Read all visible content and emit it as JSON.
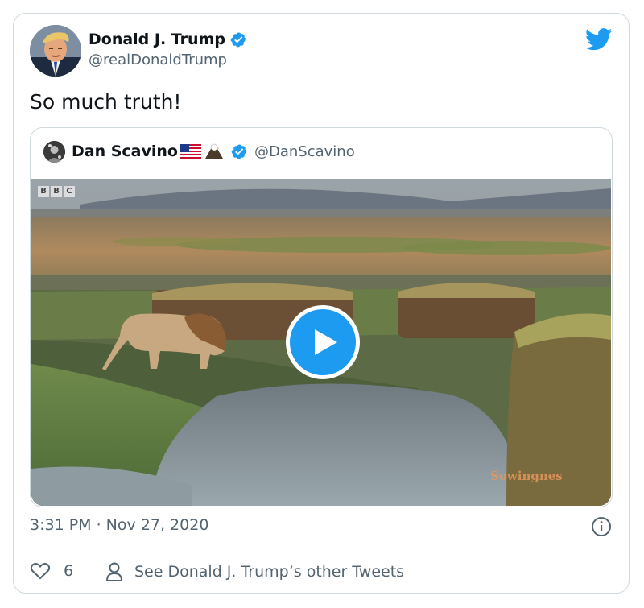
{
  "author": {
    "name": "Donald J. Trump",
    "handle": "@realDonaldTrump",
    "verified": true
  },
  "tweet": {
    "text": "So much truth!",
    "timestamp": "3:31 PM · Nov 27, 2020"
  },
  "quoted_tweet": {
    "name": "Dan Scavino",
    "emojis": [
      "us-flag",
      "eagle"
    ],
    "handle": "@DanScavino",
    "verified": true,
    "video": {
      "channel_logo": [
        "B",
        "B",
        "C"
      ],
      "watermark": "Sowingnes"
    }
  },
  "actions": {
    "likes_count": "6",
    "other_tweets_label": "See Donald J. Trump’s other Tweets"
  },
  "colors": {
    "twitter_blue": "#1d9bf0",
    "border": "#cfd9de",
    "secondary_text": "#536471"
  },
  "icons": [
    "twitter-bird-icon",
    "verified-badge-icon",
    "play-icon",
    "info-icon",
    "heart-icon",
    "person-icon"
  ]
}
